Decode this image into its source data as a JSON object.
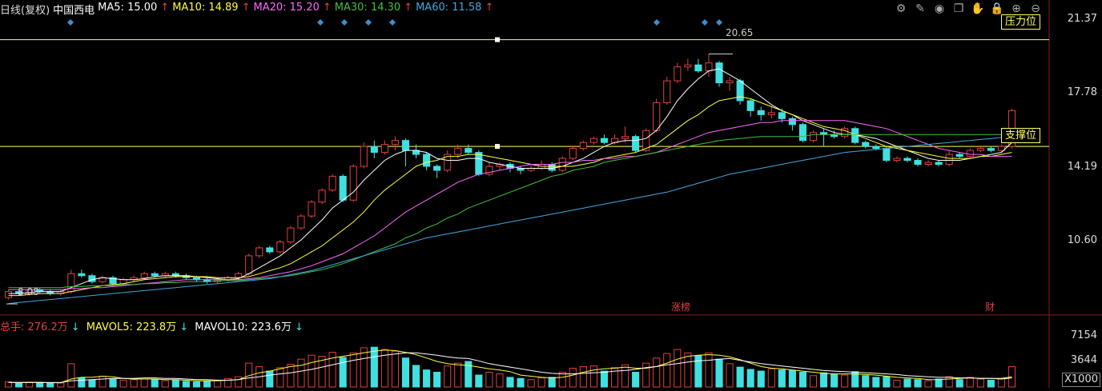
{
  "price_legend": {
    "period": "日线(复权)",
    "stock": "中国西电",
    "ma5": "MA5: 15.00",
    "ma10": "MA10: 14.89",
    "ma20": "MA20: 15.20",
    "ma30": "MA30: 14.30",
    "ma60": "MA60: 11.58",
    "arrow_up": "↑"
  },
  "volume_legend": {
    "total": "总手: 276.2万",
    "mavol5": "MAVOL5: 223.8万",
    "mavol10": "MAVOL10: 223.6万",
    "arrow_down": "↓"
  },
  "price_axis": [
    "21.37",
    "17.78",
    "14.19",
    "10.60"
  ],
  "volume_axis": [
    "7154",
    "3644"
  ],
  "volume_unit": "X1000",
  "annotations": {
    "high_label": "20.65",
    "low_label": "8.08",
    "resistance": "压力位",
    "support": "支撑位",
    "event_limit": "涨榜",
    "event_fin": "财"
  },
  "toolbar": [
    {
      "name": "settings-icon",
      "glyph": "⚙"
    },
    {
      "name": "draw-line-icon",
      "glyph": "✎"
    },
    {
      "name": "eye-icon",
      "glyph": "◉"
    },
    {
      "name": "copy-icon",
      "glyph": "❐"
    },
    {
      "name": "hand-icon",
      "glyph": "✋"
    },
    {
      "name": "lock-icon",
      "glyph": "🔒"
    },
    {
      "name": "zoom-in-icon",
      "glyph": "⊕"
    },
    {
      "name": "zoom-out-icon",
      "glyph": "⊖"
    }
  ],
  "colors": {
    "up": "#e04040",
    "down": "#40e0e0",
    "ma5": "#ffffff",
    "ma10": "#ffff40",
    "ma20": "#ff66ff",
    "ma30": "#40c040",
    "ma60": "#40a8e0",
    "hline": "#ffff66"
  },
  "chart_data": {
    "type": "candlestick",
    "ylim": [
      7.6,
      22.4
    ],
    "high_mark": 20.65,
    "low_mark": 8.08,
    "resistance_level": 21.37,
    "support_level": 16.0,
    "candles": [
      [
        8.4,
        8.7,
        8.3,
        8.8
      ],
      [
        8.7,
        8.6,
        8.5,
        8.8
      ],
      [
        8.6,
        8.8,
        8.5,
        8.9
      ],
      [
        8.8,
        8.7,
        8.6,
        8.9
      ],
      [
        8.7,
        8.6,
        8.5,
        8.8
      ],
      [
        8.6,
        8.7,
        8.5,
        8.8
      ],
      [
        8.7,
        9.6,
        8.6,
        9.8
      ],
      [
        9.6,
        9.5,
        9.4,
        9.8
      ],
      [
        9.5,
        9.2,
        9.1,
        9.6
      ],
      [
        9.2,
        9.4,
        9.1,
        9.5
      ],
      [
        9.4,
        9.1,
        9.0,
        9.5
      ],
      [
        9.1,
        9.3,
        9.0,
        9.4
      ],
      [
        9.3,
        9.4,
        9.2,
        9.5
      ],
      [
        9.4,
        9.6,
        9.3,
        9.7
      ],
      [
        9.6,
        9.5,
        9.4,
        9.7
      ],
      [
        9.5,
        9.6,
        9.4,
        9.7
      ],
      [
        9.6,
        9.5,
        9.4,
        9.7
      ],
      [
        9.5,
        9.4,
        9.3,
        9.6
      ],
      [
        9.4,
        9.3,
        9.2,
        9.5
      ],
      [
        9.3,
        9.2,
        9.1,
        9.4
      ],
      [
        9.2,
        9.3,
        9.1,
        9.4
      ],
      [
        9.3,
        9.4,
        9.2,
        9.5
      ],
      [
        9.4,
        9.6,
        9.3,
        9.7
      ],
      [
        9.6,
        10.5,
        9.5,
        10.6
      ],
      [
        10.5,
        10.9,
        10.4,
        11.0
      ],
      [
        10.9,
        10.7,
        10.6,
        11.0
      ],
      [
        10.7,
        11.2,
        10.6,
        11.3
      ],
      [
        11.2,
        11.9,
        11.1,
        12.0
      ],
      [
        11.9,
        12.5,
        11.8,
        12.6
      ],
      [
        12.5,
        13.2,
        12.4,
        13.3
      ],
      [
        13.2,
        13.8,
        13.1,
        13.9
      ],
      [
        13.8,
        14.5,
        13.7,
        14.6
      ],
      [
        14.5,
        13.3,
        13.2,
        14.6
      ],
      [
        13.3,
        15.0,
        13.2,
        15.1
      ],
      [
        15.0,
        16.0,
        14.9,
        16.2
      ],
      [
        16.0,
        15.7,
        15.4,
        16.3
      ],
      [
        15.7,
        16.1,
        15.6,
        16.3
      ],
      [
        16.1,
        16.3,
        15.8,
        16.5
      ],
      [
        16.3,
        15.8,
        15.0,
        16.4
      ],
      [
        15.8,
        15.6,
        15.4,
        16.1
      ],
      [
        15.6,
        15.0,
        14.8,
        15.7
      ],
      [
        15.0,
        14.8,
        14.4,
        15.1
      ],
      [
        14.8,
        15.6,
        14.7,
        15.8
      ],
      [
        15.6,
        15.9,
        15.4,
        16.1
      ],
      [
        15.9,
        15.7,
        15.6,
        16.1
      ],
      [
        15.7,
        14.6,
        14.5,
        15.8
      ],
      [
        14.6,
        15.0,
        14.5,
        15.2
      ],
      [
        15.0,
        15.1,
        14.8,
        15.2
      ],
      [
        15.1,
        14.9,
        14.7,
        15.2
      ],
      [
        14.9,
        14.8,
        14.6,
        15.0
      ],
      [
        14.8,
        14.9,
        14.7,
        15.1
      ],
      [
        14.9,
        15.1,
        14.8,
        15.3
      ],
      [
        15.1,
        14.8,
        14.7,
        15.2
      ],
      [
        14.8,
        15.4,
        14.7,
        15.5
      ],
      [
        15.4,
        15.9,
        15.3,
        16.0
      ],
      [
        15.9,
        16.2,
        15.8,
        16.3
      ],
      [
        16.2,
        16.4,
        16.1,
        16.5
      ],
      [
        16.4,
        16.2,
        16.1,
        16.6
      ],
      [
        16.2,
        16.4,
        16.1,
        16.6
      ],
      [
        16.4,
        16.5,
        16.2,
        17.0
      ],
      [
        16.5,
        15.8,
        15.7,
        16.6
      ],
      [
        15.8,
        16.8,
        15.7,
        16.9
      ],
      [
        16.8,
        18.2,
        16.7,
        18.4
      ],
      [
        18.2,
        19.3,
        18.1,
        19.5
      ],
      [
        19.3,
        20.0,
        19.2,
        20.2
      ],
      [
        20.0,
        20.1,
        19.8,
        20.4
      ],
      [
        20.1,
        19.8,
        19.7,
        20.4
      ],
      [
        19.8,
        20.2,
        19.5,
        20.65
      ],
      [
        20.2,
        19.2,
        19.0,
        20.3
      ],
      [
        19.2,
        19.3,
        18.8,
        19.5
      ],
      [
        19.3,
        18.3,
        18.1,
        19.4
      ],
      [
        18.3,
        17.8,
        17.5,
        18.4
      ],
      [
        17.8,
        17.6,
        17.3,
        18.0
      ],
      [
        17.6,
        17.7,
        17.4,
        18.0
      ],
      [
        17.7,
        17.4,
        17.2,
        17.9
      ],
      [
        17.4,
        17.1,
        16.8,
        17.5
      ],
      [
        17.1,
        16.3,
        16.2,
        17.2
      ],
      [
        16.3,
        16.7,
        16.2,
        16.8
      ],
      [
        16.7,
        16.6,
        16.0,
        16.9
      ],
      [
        16.6,
        16.5,
        16.4,
        16.8
      ],
      [
        16.5,
        16.9,
        16.4,
        17.0
      ],
      [
        16.9,
        16.2,
        16.1,
        17.0
      ],
      [
        16.2,
        16.0,
        15.9,
        16.3
      ],
      [
        16.0,
        15.9,
        15.8,
        16.1
      ],
      [
        15.9,
        15.3,
        15.2,
        16.0
      ],
      [
        15.3,
        15.4,
        15.2,
        15.5
      ],
      [
        15.4,
        15.3,
        15.2,
        15.5
      ],
      [
        15.3,
        15.1,
        15.0,
        15.4
      ],
      [
        15.1,
        15.2,
        15.0,
        15.3
      ],
      [
        15.2,
        15.1,
        15.0,
        15.3
      ],
      [
        15.1,
        15.6,
        15.0,
        15.8
      ],
      [
        15.6,
        15.5,
        15.4,
        15.7
      ],
      [
        15.5,
        15.8,
        15.4,
        15.9
      ],
      [
        15.8,
        15.9,
        15.7,
        16.0
      ],
      [
        15.9,
        15.8,
        15.7,
        16.0
      ],
      [
        15.8,
        16.0,
        15.7,
        16.1
      ],
      [
        16.0,
        17.8,
        15.9,
        17.9
      ]
    ],
    "ma": {
      "ma5": [
        8.6,
        8.6,
        8.65,
        8.7,
        8.7,
        8.7,
        8.9,
        9.1,
        9.3,
        9.4,
        9.35,
        9.3,
        9.3,
        9.35,
        9.45,
        9.5,
        9.5,
        9.5,
        9.45,
        9.4,
        9.35,
        9.3,
        9.35,
        9.6,
        9.9,
        10.2,
        10.5,
        10.9,
        11.3,
        11.8,
        12.3,
        12.9,
        13.3,
        13.7,
        14.3,
        14.8,
        15.3,
        15.6,
        15.8,
        15.8,
        15.7,
        15.4,
        15.3,
        15.3,
        15.4,
        15.4,
        15.2,
        15.1,
        15.0,
        14.9,
        14.9,
        14.9,
        14.9,
        15.0,
        15.2,
        15.4,
        15.7,
        16.0,
        16.2,
        16.3,
        16.3,
        16.4,
        16.8,
        17.5,
        18.3,
        18.9,
        19.4,
        19.8,
        19.9,
        19.6,
        19.3,
        18.9,
        18.5,
        18.1,
        17.8,
        17.6,
        17.3,
        17.1,
        16.9,
        16.7,
        16.6,
        16.6,
        16.5,
        16.4,
        16.2,
        16.0,
        15.8,
        15.6,
        15.4,
        15.3,
        15.3,
        15.3,
        15.4,
        15.5,
        15.6,
        15.7,
        16.2
      ],
      "ma10": [
        8.5,
        8.5,
        8.55,
        8.6,
        8.6,
        8.6,
        8.7,
        8.8,
        8.9,
        9.0,
        9.05,
        9.1,
        9.2,
        9.3,
        9.35,
        9.4,
        9.45,
        9.45,
        9.45,
        9.45,
        9.4,
        9.4,
        9.4,
        9.45,
        9.6,
        9.75,
        9.9,
        10.1,
        10.4,
        10.7,
        11.0,
        11.4,
        11.8,
        12.2,
        12.7,
        13.3,
        13.8,
        14.2,
        14.6,
        15.0,
        15.2,
        15.3,
        15.5,
        15.5,
        15.6,
        15.6,
        15.5,
        15.4,
        15.3,
        15.2,
        15.1,
        15.0,
        15.0,
        15.0,
        15.0,
        15.1,
        15.2,
        15.4,
        15.5,
        15.6,
        15.7,
        15.9,
        16.1,
        16.5,
        16.9,
        17.3,
        17.6,
        18.0,
        18.3,
        18.4,
        18.5,
        18.4,
        18.2,
        18.0,
        17.8,
        17.6,
        17.4,
        17.2,
        17.0,
        16.9,
        16.8,
        16.6,
        16.4,
        16.2,
        16.0,
        15.9,
        15.8,
        15.7,
        15.6,
        15.5,
        15.4,
        15.4,
        15.4,
        15.5,
        15.5,
        15.6,
        15.7
      ],
      "ma20": [
        8.8,
        8.8,
        8.8,
        8.8,
        8.8,
        8.8,
        8.85,
        8.85,
        8.9,
        8.9,
        8.95,
        9.0,
        9.05,
        9.1,
        9.15,
        9.2,
        9.25,
        9.3,
        9.3,
        9.3,
        9.3,
        9.3,
        9.3,
        9.35,
        9.4,
        9.5,
        9.6,
        9.7,
        9.85,
        10.0,
        10.2,
        10.4,
        10.6,
        10.9,
        11.2,
        11.5,
        11.9,
        12.3,
        12.7,
        13.0,
        13.3,
        13.6,
        13.9,
        14.2,
        14.4,
        14.6,
        14.7,
        14.8,
        14.9,
        15.0,
        15.1,
        15.1,
        15.1,
        15.2,
        15.2,
        15.3,
        15.3,
        15.4,
        15.4,
        15.5,
        15.5,
        15.6,
        15.7,
        15.9,
        16.1,
        16.3,
        16.5,
        16.7,
        16.8,
        16.9,
        17.0,
        17.1,
        17.2,
        17.2,
        17.3,
        17.3,
        17.3,
        17.3,
        17.3,
        17.3,
        17.3,
        17.2,
        17.1,
        17.0,
        16.9,
        16.7,
        16.5,
        16.3,
        16.1,
        15.9,
        15.8,
        15.7,
        15.6,
        15.6,
        15.5,
        15.5,
        15.5
      ],
      "ma30": [
        8.9,
        8.9,
        8.9,
        8.9,
        8.9,
        8.9,
        8.95,
        8.95,
        9.0,
        9.0,
        9.0,
        9.05,
        9.05,
        9.1,
        9.1,
        9.15,
        9.15,
        9.2,
        9.2,
        9.2,
        9.25,
        9.25,
        9.25,
        9.3,
        9.35,
        9.4,
        9.45,
        9.5,
        9.6,
        9.7,
        9.8,
        9.95,
        10.1,
        10.3,
        10.5,
        10.7,
        10.9,
        11.1,
        11.4,
        11.6,
        11.9,
        12.1,
        12.4,
        12.6,
        12.9,
        13.1,
        13.3,
        13.5,
        13.7,
        13.9,
        14.1,
        14.3,
        14.5,
        14.6,
        14.8,
        14.9,
        15.0,
        15.2,
        15.3,
        15.4,
        15.5,
        15.6,
        15.7,
        15.8,
        15.9,
        16.0,
        16.1,
        16.2,
        16.3,
        16.35,
        16.4,
        16.45,
        16.5,
        16.5,
        16.5,
        16.5,
        16.5,
        16.6,
        16.6,
        16.6,
        16.6,
        16.6,
        16.6,
        16.6,
        16.6,
        16.6,
        16.6,
        16.6,
        16.6,
        16.6,
        16.6,
        16.6,
        16.6,
        16.6,
        16.6,
        16.6,
        16.6
      ],
      "ma60": [
        8.1,
        8.15,
        8.2,
        8.25,
        8.3,
        8.35,
        8.4,
        8.45,
        8.5,
        8.55,
        8.6,
        8.65,
        8.7,
        8.75,
        8.8,
        8.85,
        8.9,
        8.95,
        9.0,
        9.05,
        9.1,
        9.15,
        9.2,
        9.25,
        9.3,
        9.35,
        9.45,
        9.55,
        9.65,
        9.75,
        9.9,
        10.05,
        10.2,
        10.35,
        10.5,
        10.65,
        10.8,
        10.95,
        11.1,
        11.25,
        11.4,
        11.5,
        11.6,
        11.7,
        11.8,
        11.9,
        12.0,
        12.1,
        12.2,
        12.3,
        12.4,
        12.5,
        12.6,
        12.7,
        12.8,
        12.9,
        13.0,
        13.1,
        13.2,
        13.3,
        13.4,
        13.5,
        13.6,
        13.7,
        13.85,
        14.0,
        14.15,
        14.3,
        14.45,
        14.6,
        14.7,
        14.8,
        14.9,
        15.0,
        15.1,
        15.2,
        15.3,
        15.4,
        15.5,
        15.6,
        15.7,
        15.75,
        15.8,
        15.85,
        15.9,
        15.95,
        16.0,
        16.05,
        16.1,
        16.15,
        16.2,
        16.25,
        16.3,
        16.35,
        16.4,
        16.45,
        16.5
      ]
    },
    "volume_ylim": [
      0,
      9000
    ],
    "volume": [
      900,
      700,
      850,
      800,
      650,
      700,
      4100,
      1600,
      1200,
      1900,
      1400,
      1200,
      1300,
      1400,
      1300,
      1100,
      1200,
      1000,
      900,
      1000,
      1200,
      1500,
      1800,
      4200,
      3600,
      2800,
      3400,
      4000,
      4900,
      5600,
      5400,
      6100,
      5200,
      6000,
      6900,
      7000,
      6600,
      6300,
      5100,
      3800,
      3000,
      2600,
      3700,
      4200,
      4500,
      2100,
      2600,
      2300,
      1700,
      1500,
      1300,
      1600,
      1700,
      2600,
      3300,
      3600,
      3700,
      2800,
      3400,
      3900,
      2600,
      4200,
      5100,
      5900,
      6600,
      6000,
      5500,
      6000,
      4900,
      4100,
      3500,
      3100,
      2800,
      3200,
      3000,
      2900,
      2600,
      2000,
      2500,
      2200,
      2100,
      2700,
      2000,
      1700,
      1800,
      1200,
      1400,
      1300,
      1100,
      1400,
      1800,
      1300,
      1700,
      1400,
      1200,
      1500,
      3600
    ],
    "mavol5": [
      800,
      780,
      790,
      800,
      760,
      760,
      1400,
      1700,
      1700,
      1900,
      1800,
      1500,
      1400,
      1400,
      1400,
      1300,
      1300,
      1200,
      1100,
      1100,
      1100,
      1200,
      1300,
      2000,
      2500,
      2800,
      3200,
      3600,
      3800,
      4300,
      4700,
      5100,
      5400,
      5700,
      6000,
      6300,
      6500,
      6400,
      6100,
      5700,
      5100,
      4500,
      4100,
      3900,
      3800,
      3500,
      3200,
      3000,
      2700,
      2100,
      1900,
      1700,
      1600,
      1700,
      2100,
      2600,
      3000,
      3200,
      3300,
      3500,
      3300,
      3300,
      3600,
      4200,
      4900,
      5400,
      5600,
      5700,
      5600,
      5300,
      4800,
      4200,
      3600,
      3300,
      3200,
      3000,
      2800,
      2600,
      2400,
      2300,
      2300,
      2300,
      2200,
      2100,
      1900,
      1700,
      1600,
      1500,
      1300,
      1300,
      1400,
      1500,
      1600,
      1500,
      1500,
      1500,
      1800
    ],
    "mavol10": [
      800,
      800,
      800,
      800,
      790,
      790,
      1100,
      1200,
      1300,
      1400,
      1500,
      1500,
      1500,
      1600,
      1600,
      1500,
      1500,
      1400,
      1300,
      1300,
      1200,
      1200,
      1300,
      1600,
      1800,
      2100,
      2300,
      2500,
      2800,
      3100,
      3500,
      3900,
      4300,
      4700,
      5000,
      5300,
      5600,
      5800,
      6000,
      6000,
      5800,
      5600,
      5300,
      5100,
      5000,
      4600,
      4100,
      3800,
      3500,
      3200,
      2900,
      2600,
      2400,
      2300,
      2300,
      2400,
      2500,
      2600,
      2800,
      2900,
      3100,
      3400,
      3600,
      3900,
      4100,
      4400,
      4600,
      4700,
      4900,
      5000,
      4700,
      4400,
      4100,
      3900,
      3700,
      3500,
      3300,
      3100,
      2900,
      2800,
      2700,
      2600,
      2500,
      2400,
      2300,
      2200,
      2000,
      1900,
      1800,
      1700,
      1700,
      1600,
      1600,
      1500,
      1500,
      1400,
      1600
    ]
  }
}
